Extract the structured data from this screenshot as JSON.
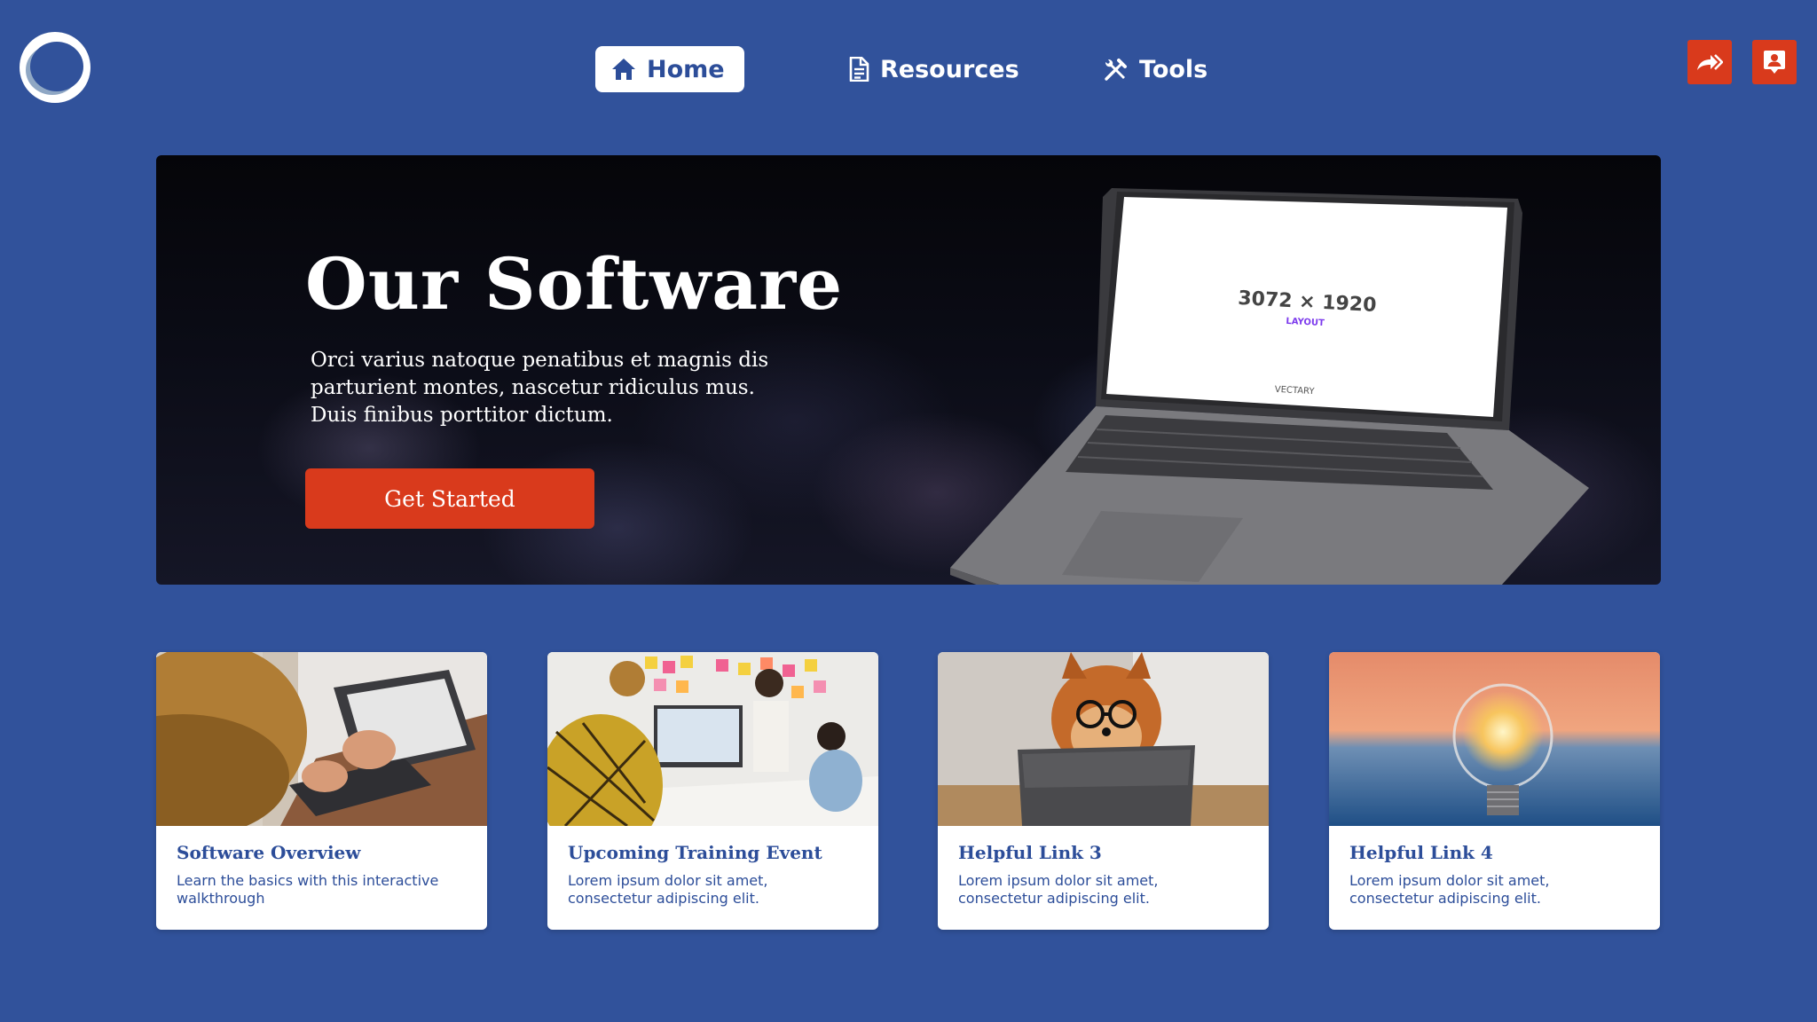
{
  "logo": {
    "icon": "ring-logo-icon"
  },
  "nav": {
    "items": [
      {
        "label": "Home",
        "icon": "home-icon",
        "active": true
      },
      {
        "label": "Resources",
        "icon": "document-icon",
        "active": false
      },
      {
        "label": "Tools",
        "icon": "tools-icon",
        "active": false
      }
    ]
  },
  "top_actions": [
    {
      "icon": "share-forward-icon"
    },
    {
      "icon": "contact-card-icon"
    }
  ],
  "hero": {
    "title": "Our Software",
    "description": "Orci varius natoque penatibus et magnis dis parturient montes, nascetur ridiculus mus. Duis finibus porttitor dictum.",
    "cta_label": "Get Started",
    "laptop_screen": {
      "size_text": "3072 × 1920",
      "sub_text": "LAYOUT",
      "brand": "VECTARY"
    }
  },
  "cards": [
    {
      "title": "Software Overview",
      "description": "Learn the basics with this interactive walkthrough",
      "image": "person-typing-on-laptop"
    },
    {
      "title": "Upcoming Training Event",
      "description": "Lorem ipsum dolor sit amet, consectetur adipiscing elit.",
      "image": "team-meeting-whiteboard"
    },
    {
      "title": "Helpful Link 3",
      "description": "Lorem ipsum dolor sit amet, consectetur adipiscing elit.",
      "image": "dog-with-glasses-tablet"
    },
    {
      "title": "Helpful Link 4",
      "description": "Lorem ipsum dolor sit amet, consectetur adipiscing elit.",
      "image": "lightbulb-at-sunset"
    }
  ],
  "colors": {
    "background": "#31529b",
    "accent": "#d93a1c",
    "text_primary": "#2c4d99",
    "white": "#ffffff"
  }
}
